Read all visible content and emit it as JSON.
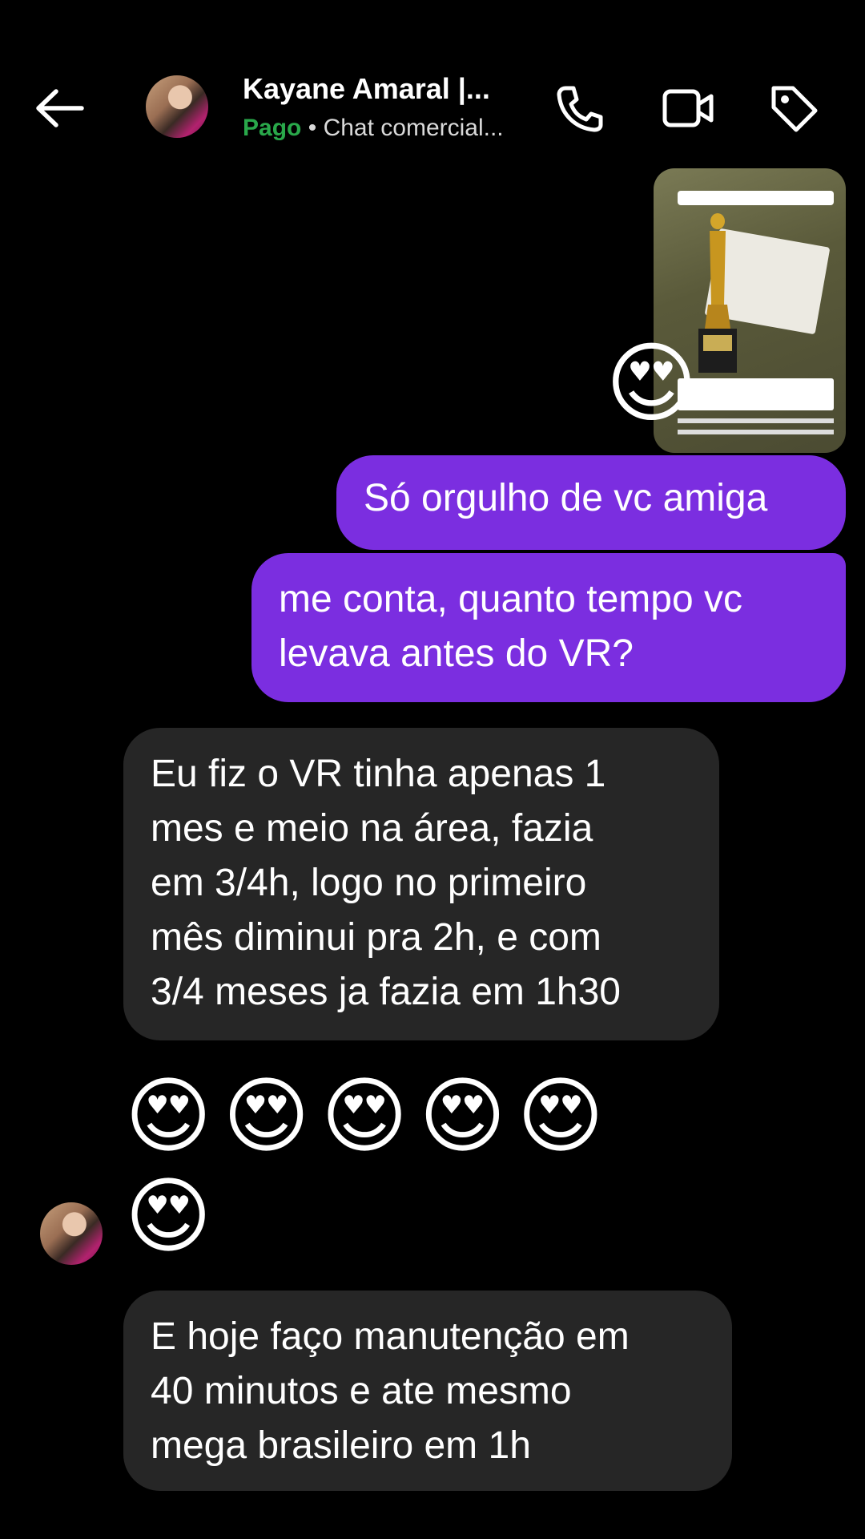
{
  "header": {
    "back_icon": "arrow-left-icon",
    "contact_name": "Kayane Amaral |...",
    "status_paid": "Pago",
    "status_separator": "•",
    "status_label": "Chat comercial...",
    "icons": [
      "phone-icon",
      "video-icon",
      "tag-icon"
    ]
  },
  "messages": [
    {
      "type": "story_reply",
      "reaction": "😍"
    },
    {
      "from": "me",
      "text": "Só orgulho de vc amiga"
    },
    {
      "from": "me",
      "lines": [
        "me conta, quanto tempo vc",
        "levava antes do VR?"
      ]
    },
    {
      "from": "them",
      "lines": [
        "Eu fiz o VR tinha apenas 1",
        "mes e meio na área, fazia",
        "em 3/4h, logo no primeiro",
        "mês diminui pra 2h, e com",
        "3/4 meses ja fazia em 1h30"
      ]
    },
    {
      "from": "them",
      "emoji_row1": "😍😍😍😍😍",
      "emoji_row2": "😍"
    },
    {
      "from": "them",
      "lines": [
        "E hoje faço manutenção em",
        "40 minutos e ate mesmo",
        "mega brasileiro em 1h"
      ]
    }
  ],
  "colors": {
    "outgoing": "#7b2ee0",
    "incoming": "#262626",
    "paid": "#29a84a"
  }
}
